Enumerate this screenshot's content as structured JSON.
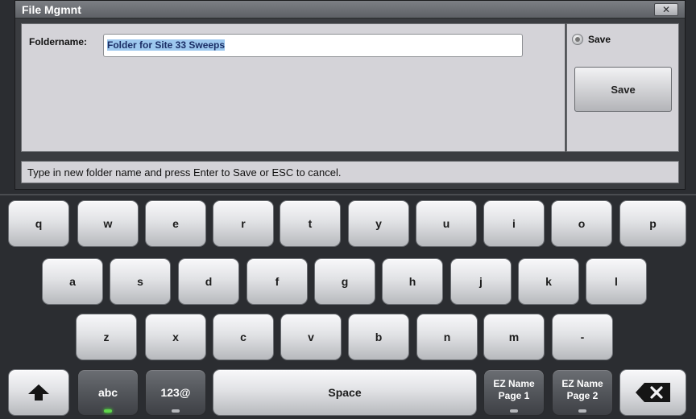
{
  "dialog": {
    "title": "File Mgmnt",
    "close_label": "✕",
    "folder_label": "Foldername:",
    "folder_value": "Folder for Site 33 Sweeps",
    "save_radio_label": "Save",
    "save_button_label": "Save",
    "status": "Type in new folder name and press Enter to Save or ESC to cancel."
  },
  "keyboard": {
    "row1": [
      "q",
      "w",
      "e",
      "r",
      "t",
      "y",
      "u",
      "i",
      "o",
      "p"
    ],
    "row2": [
      "a",
      "s",
      "d",
      "f",
      "g",
      "h",
      "j",
      "k",
      "l"
    ],
    "row3": [
      "z",
      "x",
      "c",
      "v",
      "b",
      "n",
      "m",
      "-"
    ],
    "shift_icon": "shift-arrow-icon",
    "abc_label": "abc",
    "num_label": "123@",
    "space_label": "Space",
    "ez_page1_line1": "EZ Name",
    "ez_page1_line2": "Page 1",
    "ez_page2_line1": "EZ Name",
    "ez_page2_line2": "Page 2",
    "backspace_icon": "backspace-icon",
    "indicator_on_color": "#5fd64b"
  }
}
